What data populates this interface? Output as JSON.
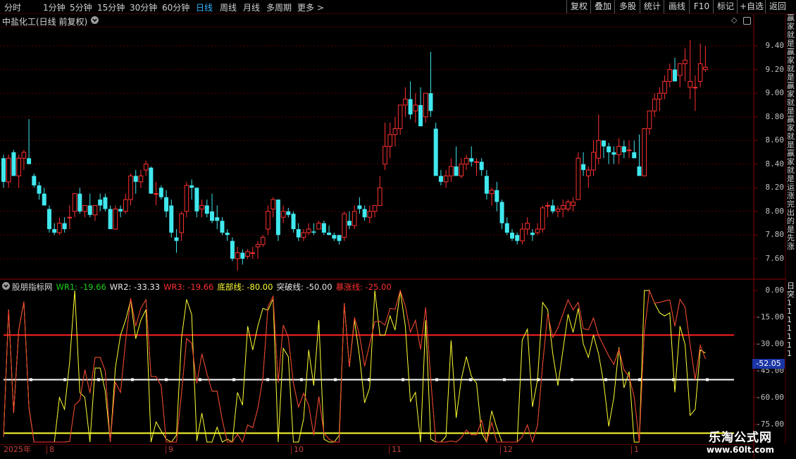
{
  "toolbar": {
    "timeframes": [
      "分时",
      "1分钟",
      "5分钟",
      "15分钟",
      "30分钟",
      "60分钟",
      "日线",
      "周线",
      "月线",
      "多周期",
      "更多 >"
    ],
    "active_timeframe": "日线",
    "buttons": [
      "复权",
      "叠加",
      "多股",
      "统计",
      "画线",
      "F10",
      "标记",
      "+自选",
      "返回"
    ]
  },
  "chart_title": "中盐化工(日线 前复权)",
  "price_axis": [
    "9.40",
    "9.20",
    "9.00",
    "8.80",
    "8.60",
    "8.40",
    "8.20",
    "8.00",
    "7.80",
    "7.60"
  ],
  "indicator": {
    "name": "股朋指标网",
    "items": [
      {
        "text": "WR1: -19.66",
        "color": "#1fd01f"
      },
      {
        "text": "WR2: -33.33",
        "color": "#e8e8e8"
      },
      {
        "text": "WR3: -19.66",
        "color": "#ff3030"
      },
      {
        "text": "底部线: -80.00",
        "color": "#ffff33"
      },
      {
        "text": "突破线: -50.00",
        "color": "#e8e8e8"
      },
      {
        "text": "暴涨线: -25.00",
        "color": "#ff3030"
      }
    ],
    "axis": [
      "0.00",
      "-15.00",
      "-30.00",
      "-45.00",
      "-60.00",
      "-75.00"
    ],
    "current_tag": "-52.05"
  },
  "xaxis": [
    "2025年",
    "8",
    "9",
    "10",
    "11",
    "12",
    "1"
  ],
  "sidebar_text": "赢家就是赢家就是赢家就是赢家就是赢家就是运涨完出的是先涨",
  "sidebar_right_text": "日突1111111",
  "watermark": {
    "line1": "乐淘公式网",
    "line2": "www.60lt.com"
  },
  "colors": {
    "up": "#ff3030",
    "down": "#40e8ee",
    "grid": "#5a0000",
    "active": "#33b5ff"
  },
  "chart_data": {
    "type": "candlestick",
    "y_range": [
      7.45,
      9.55
    ],
    "candles": [
      [
        8.45,
        8.48,
        8.2,
        8.25
      ],
      [
        8.25,
        8.48,
        8.2,
        8.45
      ],
      [
        8.5,
        8.52,
        8.3,
        8.3
      ],
      [
        8.3,
        8.48,
        8.2,
        8.45
      ],
      [
        8.45,
        8.52,
        8.35,
        8.5
      ],
      [
        8.45,
        8.78,
        8.4,
        8.4
      ],
      [
        8.3,
        8.32,
        8.2,
        8.22
      ],
      [
        8.22,
        8.25,
        8.1,
        8.15
      ],
      [
        8.15,
        8.2,
        8.05,
        8.05
      ],
      [
        8.02,
        8.05,
        7.82,
        7.85
      ],
      [
        7.85,
        7.9,
        7.8,
        7.82
      ],
      [
        7.82,
        7.95,
        7.8,
        7.9
      ],
      [
        7.9,
        7.95,
        7.82,
        7.85
      ],
      [
        7.95,
        8.05,
        7.85,
        7.95
      ],
      [
        8.0,
        8.15,
        7.95,
        8.15
      ],
      [
        8.15,
        8.2,
        7.98,
        8.0
      ],
      [
        8.0,
        8.05,
        7.95,
        8.05
      ],
      [
        8.05,
        8.15,
        7.95,
        7.97
      ],
      [
        7.97,
        8.05,
        7.92,
        8.05
      ],
      [
        8.1,
        8.15,
        8.0,
        8.05
      ],
      [
        8.12,
        8.15,
        8.0,
        8.02
      ],
      [
        8.02,
        8.05,
        7.85,
        7.85
      ],
      [
        7.85,
        8.05,
        7.85,
        8.02
      ],
      [
        8.02,
        8.05,
        7.95,
        8.0
      ],
      [
        8.0,
        8.15,
        7.98,
        8.1
      ],
      [
        8.1,
        8.32,
        8.05,
        8.3
      ],
      [
        8.3,
        8.35,
        8.15,
        8.25
      ],
      [
        8.25,
        8.35,
        8.2,
        8.3
      ],
      [
        8.35,
        8.43,
        8.3,
        8.4
      ],
      [
        8.37,
        8.38,
        8.15,
        8.15
      ],
      [
        8.15,
        8.25,
        8.05,
        8.15
      ],
      [
        8.2,
        8.22,
        8.1,
        8.12
      ],
      [
        8.12,
        8.18,
        7.95,
        8.0
      ],
      [
        8.05,
        8.1,
        7.78,
        7.82
      ],
      [
        7.78,
        7.85,
        7.65,
        7.75
      ],
      [
        7.82,
        8.0,
        7.75,
        7.98
      ],
      [
        8.0,
        8.25,
        7.95,
        8.22
      ],
      [
        8.22,
        8.27,
        8.1,
        8.2
      ],
      [
        8.2,
        8.2,
        7.95,
        8.0
      ],
      [
        8.02,
        8.1,
        7.95,
        8.05
      ],
      [
        8.05,
        8.1,
        7.95,
        7.98
      ],
      [
        8.0,
        8.15,
        7.9,
        7.92
      ],
      [
        7.95,
        8.05,
        7.85,
        7.92
      ],
      [
        7.92,
        7.95,
        7.8,
        7.82
      ],
      [
        7.82,
        7.85,
        7.75,
        7.8
      ],
      [
        7.75,
        7.78,
        7.58,
        7.6
      ],
      [
        7.6,
        7.7,
        7.5,
        7.65
      ],
      [
        7.65,
        7.68,
        7.55,
        7.6
      ],
      [
        7.62,
        7.68,
        7.6,
        7.66
      ],
      [
        7.65,
        7.7,
        7.6,
        7.65
      ],
      [
        7.7,
        7.75,
        7.6,
        7.72
      ],
      [
        7.72,
        7.8,
        7.7,
        7.78
      ],
      [
        7.85,
        8.05,
        7.8,
        8.0
      ],
      [
        8.02,
        8.12,
        7.95,
        8.1
      ],
      [
        8.1,
        8.1,
        7.75,
        7.8
      ],
      [
        7.95,
        8.05,
        7.9,
        8.0
      ],
      [
        8.0,
        8.03,
        7.95,
        7.97
      ],
      [
        7.98,
        8.0,
        7.82,
        7.85
      ],
      [
        7.85,
        7.9,
        7.75,
        7.78
      ],
      [
        7.78,
        7.85,
        7.75,
        7.82
      ],
      [
        7.82,
        7.9,
        7.8,
        7.85
      ],
      [
        7.83,
        7.9,
        7.8,
        7.82
      ],
      [
        7.85,
        7.92,
        7.85,
        7.9
      ],
      [
        7.9,
        7.92,
        7.8,
        7.82
      ],
      [
        7.82,
        7.88,
        7.8,
        7.8
      ],
      [
        7.8,
        7.82,
        7.75,
        7.77
      ],
      [
        7.8,
        7.8,
        7.72,
        7.75
      ],
      [
        7.78,
        8.0,
        7.75,
        7.98
      ],
      [
        7.92,
        8.0,
        7.85,
        7.88
      ],
      [
        7.88,
        8.05,
        7.85,
        8.0
      ],
      [
        8.05,
        8.12,
        7.98,
        8.02
      ],
      [
        8.02,
        8.05,
        7.92,
        7.95
      ],
      [
        7.95,
        8.05,
        7.9,
        8.0
      ],
      [
        8.0,
        8.05,
        7.95,
        8.05
      ],
      [
        8.05,
        8.3,
        8.05,
        8.2
      ],
      [
        8.4,
        8.75,
        8.35,
        8.55
      ],
      [
        8.55,
        8.75,
        8.45,
        8.65
      ],
      [
        8.65,
        8.8,
        8.55,
        8.7
      ],
      [
        8.7,
        8.9,
        8.65,
        8.9
      ],
      [
        8.9,
        9.05,
        8.8,
        8.95
      ],
      [
        8.95,
        9.1,
        8.78,
        8.82
      ],
      [
        8.85,
        9.0,
        8.75,
        8.9
      ],
      [
        8.9,
        9.05,
        8.75,
        8.72
      ],
      [
        8.8,
        9.0,
        8.75,
        9.0
      ],
      [
        9.0,
        9.35,
        8.8,
        8.85
      ],
      [
        8.7,
        8.75,
        8.3,
        8.3
      ],
      [
        8.3,
        8.35,
        8.22,
        8.25
      ],
      [
        8.25,
        8.35,
        8.2,
        8.3
      ],
      [
        8.3,
        8.45,
        8.25,
        8.38
      ],
      [
        8.38,
        8.55,
        8.3,
        8.3
      ],
      [
        8.3,
        8.45,
        8.28,
        8.4
      ],
      [
        8.4,
        8.48,
        8.35,
        8.45
      ],
      [
        8.45,
        8.55,
        8.38,
        8.42
      ],
      [
        8.42,
        8.45,
        8.3,
        8.42
      ],
      [
        8.42,
        8.45,
        8.3,
        8.35
      ],
      [
        8.3,
        8.35,
        8.1,
        8.15
      ],
      [
        8.15,
        8.2,
        8.05,
        8.18
      ],
      [
        8.18,
        8.25,
        8.0,
        8.08
      ],
      [
        8.08,
        8.1,
        7.85,
        7.9
      ],
      [
        7.9,
        7.95,
        7.8,
        7.82
      ],
      [
        7.82,
        7.85,
        7.75,
        7.77
      ],
      [
        7.8,
        7.82,
        7.72,
        7.75
      ],
      [
        7.75,
        7.9,
        7.72,
        7.85
      ],
      [
        7.85,
        7.95,
        7.8,
        7.9
      ],
      [
        7.82,
        7.85,
        7.75,
        7.8
      ],
      [
        7.82,
        7.9,
        7.8,
        7.85
      ],
      [
        7.85,
        8.05,
        7.82,
        8.03
      ],
      [
        8.05,
        8.08,
        7.95,
        8.05
      ],
      [
        8.05,
        8.1,
        7.98,
        8.0
      ],
      [
        8.0,
        8.05,
        7.95,
        8.02
      ],
      [
        8.02,
        8.1,
        7.95,
        8.05
      ],
      [
        8.02,
        8.1,
        8.0,
        8.08
      ],
      [
        8.05,
        8.12,
        8.0,
        8.08
      ],
      [
        8.1,
        8.5,
        8.1,
        8.45
      ],
      [
        8.4,
        8.5,
        8.3,
        8.35
      ],
      [
        8.3,
        8.38,
        8.2,
        8.35
      ],
      [
        8.35,
        8.6,
        8.3,
        8.5
      ],
      [
        8.45,
        8.82,
        8.4,
        8.6
      ],
      [
        8.6,
        8.6,
        8.45,
        8.55
      ],
      [
        8.55,
        8.58,
        8.4,
        8.5
      ],
      [
        8.5,
        8.55,
        8.4,
        8.48
      ],
      [
        8.48,
        8.62,
        8.4,
        8.55
      ],
      [
        8.55,
        8.6,
        8.45,
        8.5
      ],
      [
        8.52,
        8.6,
        8.45,
        8.52
      ],
      [
        8.5,
        8.6,
        8.45,
        8.45
      ],
      [
        8.38,
        8.65,
        8.35,
        8.3
      ],
      [
        8.3,
        8.7,
        8.3,
        8.7
      ],
      [
        8.7,
        8.85,
        8.65,
        8.85
      ],
      [
        8.85,
        9.0,
        8.8,
        8.95
      ],
      [
        8.95,
        9.05,
        8.85,
        9.0
      ],
      [
        9.0,
        9.15,
        8.95,
        9.1
      ],
      [
        9.1,
        9.25,
        9.05,
        9.2
      ],
      [
        9.2,
        9.3,
        9.1,
        9.1
      ],
      [
        9.15,
        9.25,
        9.05,
        9.25
      ],
      [
        9.25,
        9.38,
        9.1,
        9.28
      ],
      [
        9.05,
        9.45,
        8.95,
        9.1
      ],
      [
        9.05,
        9.15,
        8.85,
        9.05
      ],
      [
        9.1,
        9.42,
        9.05,
        9.25
      ],
      [
        9.2,
        9.4,
        9.18,
        9.22
      ]
    ]
  }
}
